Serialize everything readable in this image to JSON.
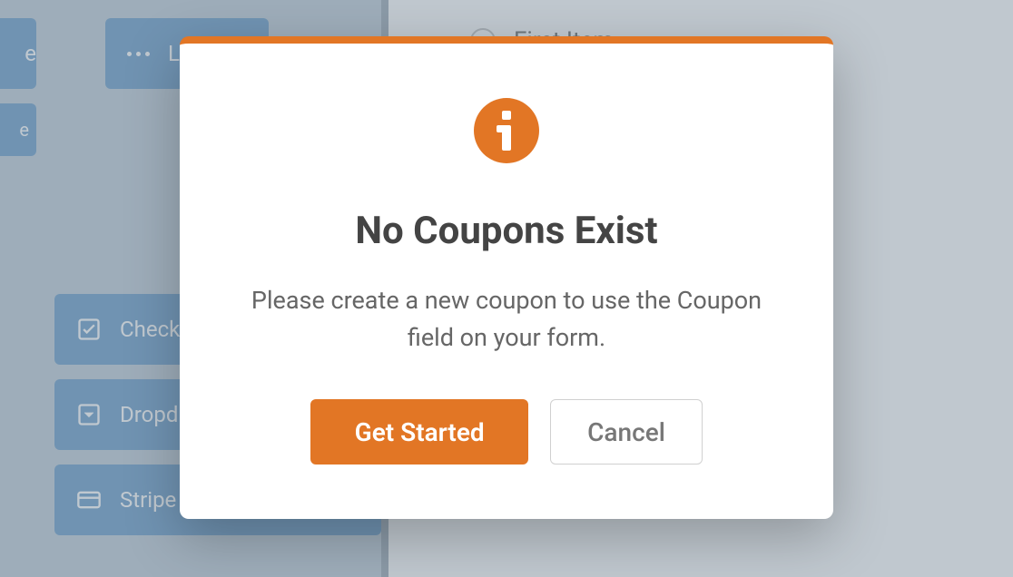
{
  "colors": {
    "accent": "#e27625",
    "button_bg": "#4e8bbf"
  },
  "sidebar": {
    "fields": {
      "likert": "Likert",
      "edge": "e",
      "checkbox": "Check",
      "dropdown": "Dropd",
      "stripe": "Stripe Credit Card"
    }
  },
  "canvas": {
    "first_item": "First Item"
  },
  "modal": {
    "title": "No Coupons Exist",
    "message": "Please create a new coupon to use the Coupon field on your form.",
    "primary_label": "Get Started",
    "cancel_label": "Cancel"
  }
}
